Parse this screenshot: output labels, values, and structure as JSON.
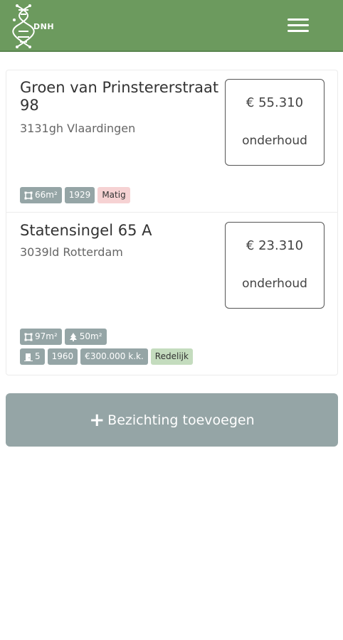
{
  "header": {
    "logo_text": "DNH",
    "menu_icon": "hamburger-menu-icon"
  },
  "listings": [
    {
      "street": "Groen van Prinstererstraat 98",
      "city": "3131gh Vlaardingen",
      "price": "€ 55.310",
      "price_label": "onderhoud",
      "tags": {
        "area": "66m²",
        "year": "1929",
        "condition": "Matig"
      }
    },
    {
      "street": "Statensingel 65 A",
      "city": "3039ld Rotterdam",
      "price": "€ 23.310",
      "price_label": "onderhoud",
      "tags": {
        "area": "97m²",
        "garden": "50m²",
        "rooms": "5",
        "year": "1960",
        "asking_price": "€300.000 k.k.",
        "condition": "Redelijk"
      }
    }
  ],
  "add_button": {
    "label": "Bezichting toevoegen"
  },
  "colors": {
    "header": "#6c9a5e",
    "tag_grey": "#95a5a6",
    "tag_bad": "#f6d2d3",
    "tag_ok": "#c4dcbe"
  }
}
